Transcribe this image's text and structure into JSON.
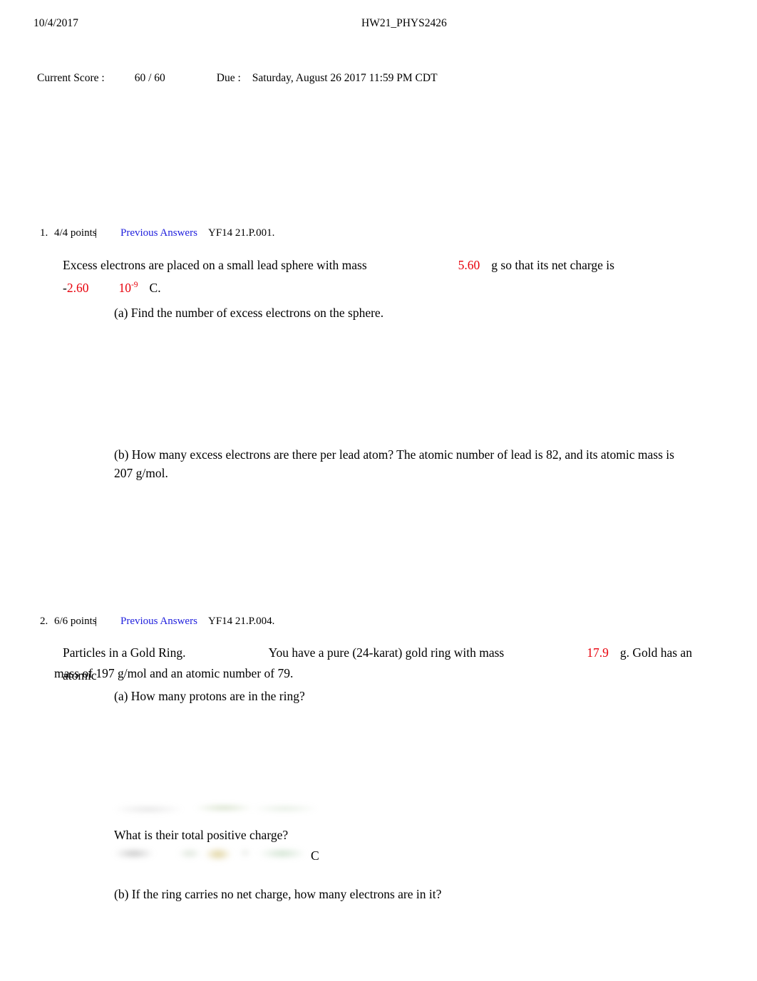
{
  "header": {
    "date": "10/4/2017",
    "title": "HW21_PHYS2426"
  },
  "summary": {
    "score_label": "Current Score :",
    "score_value": "60 / 60",
    "due_label": "Due :",
    "due_value": "Saturday, August 26 2017 11:59 PM CDT"
  },
  "problems": [
    {
      "number": "1.",
      "points": "4/4 points",
      "pipe": "|",
      "previous_answers": "Previous Answers",
      "code": "YF14 21.P.001.",
      "stem_part1": "Excess electrons are placed on a small lead sphere with mass",
      "mass_value": "5.60",
      "stem_part2": "g so that its net charge is",
      "charge_sign": "-",
      "charge_mantissa": "2.60",
      "charge_base": "10",
      "charge_exponent": "-9",
      "charge_unit": "C.",
      "part_a": "(a) Find the number of excess electrons on the sphere.",
      "part_b": "(b) How many excess electrons are there per lead atom? The atomic number of lead is 82, and its atomic mass is 207 g/mol."
    },
    {
      "number": "2.",
      "points": "6/6 points",
      "pipe": "|",
      "previous_answers": "Previous Answers",
      "code": "YF14 21.P.004.",
      "title": "Particles in a Gold Ring.",
      "stem_part1": "You have a pure (24-karat) gold ring with mass",
      "mass_value": "17.9",
      "stem_part2": "g. Gold has an atomic",
      "stem_line2": "mass of 197 g/mol and an atomic number of 79.",
      "part_a": "(a) How many protons are in the ring?",
      "charge_question": "What is their total positive charge?",
      "charge_unit": "C",
      "part_b": "(b) If the ring carries no net charge, how many electrons are in it?"
    }
  ],
  "colors": {
    "answer_red": "#e8000b",
    "link_blue": "#2020dd",
    "text_black": "#000000",
    "page_background": "#ffffff"
  }
}
